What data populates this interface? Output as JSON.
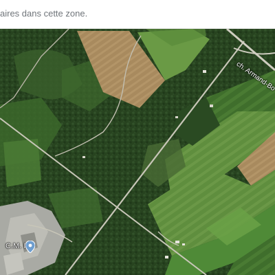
{
  "notice": {
    "text": "aires dans cette zone."
  },
  "map": {
    "view": "satellite",
    "road_label": "ch. Armand-Bo",
    "place": {
      "name": "C.M. Inc",
      "icon": "location-pin-icon",
      "pin_color": "#6e9ecf"
    },
    "colors": {
      "forest": "#27431f",
      "field_light": "#5f8e3e",
      "field_bright": "#4f8a37",
      "field_tan": "#a88a5e",
      "quarry": "#a9aaa4",
      "road": "#c8c6b8"
    }
  }
}
